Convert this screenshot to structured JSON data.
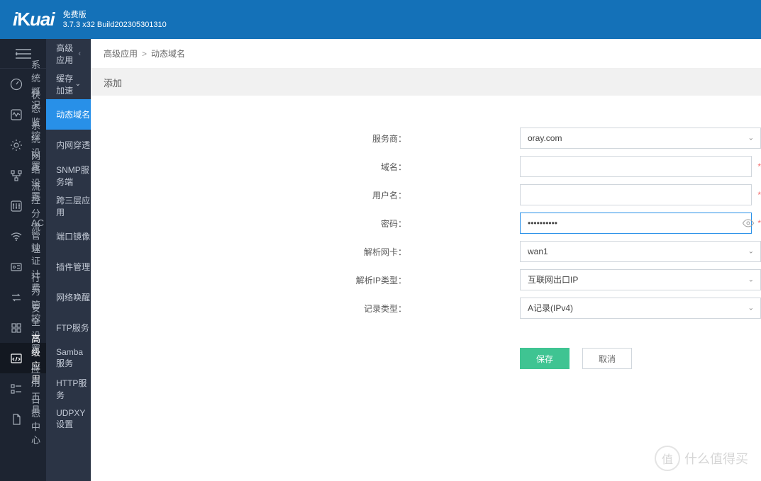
{
  "header": {
    "logo": "iKuai",
    "edition": "免费版",
    "build": "3.7.3 x32 Build202305301310"
  },
  "sidebar1": {
    "items": [
      {
        "icon": "gauge",
        "label": "系统概况"
      },
      {
        "icon": "activity",
        "label": "状态监控"
      },
      {
        "icon": "gear",
        "label": "系统设置"
      },
      {
        "icon": "network",
        "label": "网络设置"
      },
      {
        "icon": "sliders",
        "label": "流控分流"
      },
      {
        "icon": "wifi",
        "label": "AC管理"
      },
      {
        "icon": "badge",
        "label": "认证计费"
      },
      {
        "icon": "swap",
        "label": "行为管控"
      },
      {
        "icon": "shield",
        "label": "安全设置"
      },
      {
        "icon": "app",
        "label": "高级应用"
      },
      {
        "icon": "tools",
        "label": "应用工具"
      },
      {
        "icon": "log",
        "label": "日志中心"
      }
    ],
    "activeIndex": 9
  },
  "sidebar2": {
    "head": "高级应用",
    "items": [
      {
        "label": "缓存加速",
        "expand": true
      },
      {
        "label": "动态域名",
        "active": true
      },
      {
        "label": "内网穿透"
      },
      {
        "label": "SNMP服务端"
      },
      {
        "label": "跨三层应用"
      },
      {
        "label": "端口镜像"
      },
      {
        "label": "插件管理"
      },
      {
        "label": "网络唤醒"
      },
      {
        "label": "FTP服务"
      },
      {
        "label": "Samba服务"
      },
      {
        "label": "HTTP服务"
      },
      {
        "label": "UDPXY设置"
      }
    ]
  },
  "breadcrumb": {
    "a": "高级应用",
    "b": "动态域名"
  },
  "subhead": "添加",
  "form": {
    "labels": {
      "provider": "服务商：",
      "domain": "域名：",
      "username": "用户名：",
      "password": "密码：",
      "nic": "解析网卡：",
      "iptype": "解析IP类型：",
      "rectype": "记录类型："
    },
    "values": {
      "provider": "oray.com",
      "domain": "",
      "username": "",
      "password": "••••••••••",
      "nic": "wan1",
      "iptype": "互联网出口IP",
      "rectype": "A记录(IPv4)"
    },
    "required_mark": "*"
  },
  "buttons": {
    "save": "保存",
    "cancel": "取消"
  },
  "watermark": {
    "icon": "值",
    "text": "什么值得买"
  }
}
